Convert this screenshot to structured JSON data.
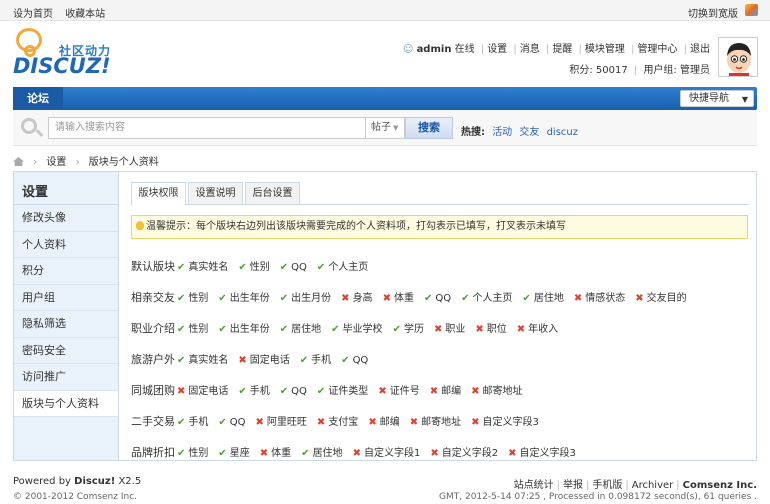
{
  "topbar": {
    "set_home": "设为首页",
    "bookmark": "收藏本站",
    "wide_switch": "切换到宽版"
  },
  "logo": {
    "tagline": "社区动力",
    "brand": "DISCUZ!"
  },
  "user": {
    "name": "admin",
    "status": "在线",
    "links": [
      "设置",
      "消息",
      "提醒",
      "模块管理",
      "管理中心",
      "退出"
    ],
    "points_label": "积分: 50017",
    "group_label": "用户组: 管理员"
  },
  "nav": {
    "forum": "论坛",
    "quick_nav": "快捷导航"
  },
  "search": {
    "placeholder": "请输入搜索内容",
    "type": "帖子",
    "button": "搜索",
    "hot_label": "热搜:",
    "hot": [
      "活动",
      "交友",
      "discuz"
    ]
  },
  "breadcrumb": [
    "设置",
    "版块与个人资料"
  ],
  "sidebar": {
    "title": "设置",
    "items": [
      {
        "label": "修改头像"
      },
      {
        "label": "个人资料"
      },
      {
        "label": "积分"
      },
      {
        "label": "用户组"
      },
      {
        "label": "隐私筛选"
      },
      {
        "label": "密码安全"
      },
      {
        "label": "访问推广"
      },
      {
        "label": "版块与个人资料",
        "active": true
      }
    ]
  },
  "tabs": [
    "版块权限",
    "设置说明",
    "后台设置"
  ],
  "tip": "温馨提示：每个版块右边列出该版块需要完成的个人资料项，打勾表示已填写，打叉表示未填写",
  "permissions": [
    {
      "category": "默认版块",
      "fields": [
        [
          "真实姓名",
          true
        ],
        [
          "性别",
          true
        ],
        [
          "QQ",
          true
        ],
        [
          "个人主页",
          true
        ]
      ]
    },
    {
      "category": "相亲交友",
      "fields": [
        [
          "性别",
          true
        ],
        [
          "出生年份",
          true
        ],
        [
          "出生月份",
          true
        ],
        [
          "身高",
          false
        ],
        [
          "体重",
          false
        ],
        [
          "QQ",
          true
        ],
        [
          "个人主页",
          true
        ],
        [
          "居住地",
          true
        ],
        [
          "情感状态",
          false
        ],
        [
          "交友目的",
          false
        ]
      ]
    },
    {
      "category": "职业介绍",
      "fields": [
        [
          "性别",
          true
        ],
        [
          "出生年份",
          true
        ],
        [
          "居住地",
          true
        ],
        [
          "毕业学校",
          true
        ],
        [
          "学历",
          true
        ],
        [
          "职业",
          false
        ],
        [
          "职位",
          false
        ],
        [
          "年收入",
          false
        ]
      ]
    },
    {
      "category": "旅游户外",
      "fields": [
        [
          "真实姓名",
          true
        ],
        [
          "固定电话",
          false
        ],
        [
          "手机",
          true
        ],
        [
          "QQ",
          true
        ]
      ]
    },
    {
      "category": "同城团购",
      "fields": [
        [
          "固定电话",
          false
        ],
        [
          "手机",
          true
        ],
        [
          "QQ",
          true
        ],
        [
          "证件类型",
          true
        ],
        [
          "证件号",
          false
        ],
        [
          "邮编",
          false
        ],
        [
          "邮寄地址",
          false
        ]
      ]
    },
    {
      "category": "二手交易",
      "fields": [
        [
          "手机",
          true
        ],
        [
          "QQ",
          true
        ],
        [
          "阿里旺旺",
          false
        ],
        [
          "支付宝",
          false
        ],
        [
          "邮编",
          false
        ],
        [
          "邮寄地址",
          false
        ],
        [
          "自定义字段3",
          false
        ]
      ]
    },
    {
      "category": "品牌折扣",
      "fields": [
        [
          "性别",
          true
        ],
        [
          "星座",
          true
        ],
        [
          "体重",
          false
        ],
        [
          "居住地",
          true
        ],
        [
          "自定义字段1",
          false
        ],
        [
          "自定义字段2",
          false
        ],
        [
          "自定义字段3",
          false
        ]
      ]
    }
  ],
  "footer": {
    "powered": "Powered by",
    "product": "Discuz!",
    "version": "X2.5",
    "copyright": "© 2001-2012 Comsenz Inc.",
    "links": [
      "站点统计",
      "举报",
      "手机版",
      "Archiver",
      "Comsenz Inc."
    ],
    "gmt": "GMT, 2012-5-14 07:25 , Processed in 0.098172 second(s), 61 queries ."
  }
}
